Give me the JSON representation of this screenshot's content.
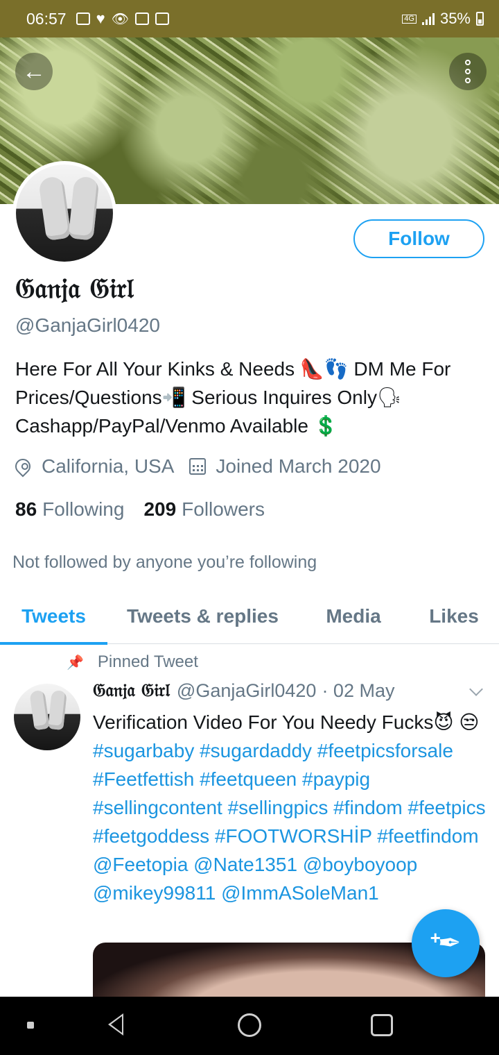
{
  "status_bar": {
    "time": "06:57",
    "network": "4G",
    "battery": "35%"
  },
  "colors": {
    "accent": "#1da1f2",
    "status_bar_bg": "#7a6f2a",
    "secondary_text": "#657786"
  },
  "profile": {
    "display_name": "𝔊𝔞𝔫𝔧𝔞 𝔊𝔦𝔯𝔩",
    "handle": "@GanjaGirl0420",
    "bio": "Here For All Your Kinks & Needs 👠👣 DM Me For Prices/Questions📲 Serious Inquires Only🗣 Cashapp/PayPal/Venmo Available 💲",
    "location": "California, USA",
    "joined": "Joined March 2020",
    "following_count": "86",
    "following_label": "Following",
    "followers_count": "209",
    "followers_label": "Followers",
    "not_followed_text": "Not followed by anyone you’re following",
    "follow_label": "Follow"
  },
  "tabs": [
    {
      "label": "Tweets",
      "active": true
    },
    {
      "label": "Tweets & replies",
      "active": false
    },
    {
      "label": "Media",
      "active": false
    },
    {
      "label": "Likes",
      "active": false
    }
  ],
  "pinned_tweet": {
    "pinned_label": "Pinned Tweet",
    "author_name": "𝔊𝔞𝔫𝔧𝔞 𝔊𝔦𝔯𝔩",
    "author_handle": "@GanjaGirl0420",
    "date": "· 02 May",
    "text_plain": "Verification Video For You Needy Fucks😈 😒",
    "tags": "#sugarbaby #sugardaddy #feetpicsforsale #Feetfettish #feetqueen #paypig #sellingcontent #sellingpics #findom #feetpics #feetgoddess #FOOTWORSHİP #feetfindom @Feetopia @Nate1351 @boyboyoop @mikey99811 @ImmASoleMan1"
  }
}
